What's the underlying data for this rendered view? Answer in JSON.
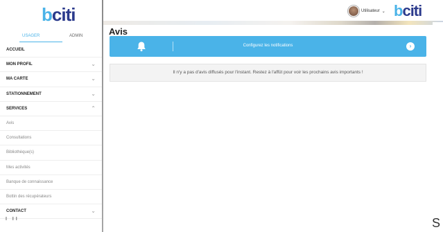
{
  "brand": {
    "logo_b": "b",
    "logo_rest": "citi"
  },
  "sidebar": {
    "tabs": [
      "USAGER",
      "ADMIN"
    ],
    "items": [
      {
        "label": "ACCUEIL",
        "type": "top",
        "chevron": ""
      },
      {
        "label": "MON PROFIL",
        "type": "top",
        "chevron": "⌄"
      },
      {
        "label": "MA CARTE",
        "type": "top",
        "chevron": "⌄"
      },
      {
        "label": "STATIONNEMENT",
        "type": "top",
        "chevron": "⌄"
      },
      {
        "label": "SERVICES",
        "type": "top",
        "chevron": "⌃"
      },
      {
        "label": "Avis",
        "type": "sub",
        "chevron": ""
      },
      {
        "label": "Consultations",
        "type": "sub",
        "chevron": ""
      },
      {
        "label": "Bibliothèque(s)",
        "type": "sub",
        "chevron": ""
      },
      {
        "label": "Mes activités",
        "type": "sub",
        "chevron": ""
      },
      {
        "label": "Banque de connaissance",
        "type": "sub",
        "chevron": ""
      },
      {
        "label": "Bottin des récupérateurs",
        "type": "sub",
        "chevron": ""
      },
      {
        "label": "CONTACT",
        "type": "top",
        "chevron": "⌄"
      }
    ],
    "footer_dots": "I II"
  },
  "header": {
    "user_label": "Utilisateur",
    "user_caret": "⌄"
  },
  "main": {
    "title": "Avis",
    "notif_text": "Configurez les notifications",
    "notif_go": "›",
    "empty_text": "Il n'y a pas d'avis diffusés pour l'instant. Restez à l'affût pour voir les prochains avis importants !"
  },
  "edge_char": "S",
  "colors": {
    "accent": "#4ab3e8",
    "brand_dark": "#2b3a8c"
  }
}
